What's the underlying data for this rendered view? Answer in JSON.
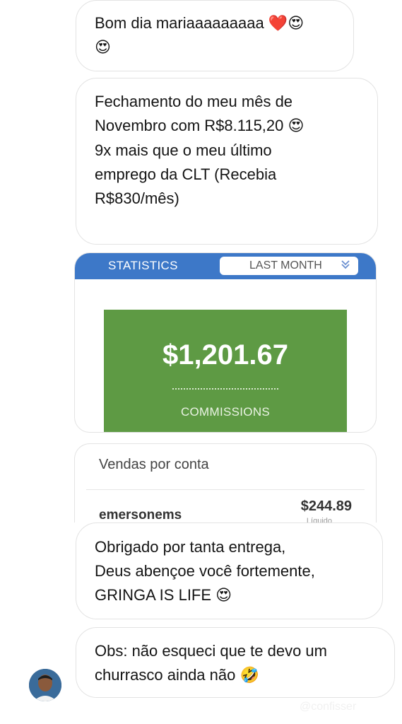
{
  "messages": [
    {
      "id": "m1",
      "lines": [
        {
          "text": "Bom dia mariaaaaaaaaa ",
          "emoji": "❤️😍"
        },
        {
          "text": "",
          "emoji": "😍"
        }
      ]
    },
    {
      "id": "m2",
      "lines": [
        {
          "text": "Fechamento do meu mês de",
          "emoji": ""
        },
        {
          "text": "Novembro com R$8.115,20 ",
          "emoji": "😍"
        }
      ],
      "lines2": [
        "9x mais que o meu último",
        "emprego da CLT (Recebia",
        "R$830/mês)"
      ]
    },
    {
      "id": "m3",
      "lines": [
        "Obrigado por tanta entrega,",
        "Deus abençoe você fortemente,",
        "GRINGA IS LIFE "
      ],
      "emoji": "😍"
    },
    {
      "id": "m4",
      "lines": [
        "Obs: não esqueci que te devo um",
        "churrasco ainda não "
      ],
      "emoji": "🤣"
    }
  ],
  "stats_card": {
    "tab_label": "STATISTICS",
    "period_label": "LAST MONTH",
    "period_icon": "chevron-double-down-icon",
    "commission_value": "$1,201.67",
    "commission_label": "COMMISSIONS",
    "accent_color": "#3d78c8",
    "box_color": "#5e9a44"
  },
  "sales_card": {
    "title": "Vendas por conta",
    "account_name": "emersonems",
    "account_amount": "$244.89",
    "account_subtext": "Líquido"
  },
  "watermark": "@confisser"
}
